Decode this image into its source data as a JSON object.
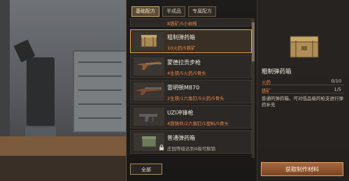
{
  "tabs": [
    {
      "label": "基础配方"
    },
    {
      "label": "半成品"
    },
    {
      "label": "专属配方"
    }
  ],
  "list": {
    "top_partial": {
      "materials": "8铁矿/5小树枝"
    },
    "items": [
      {
        "name": "粗制弹药箱",
        "materials": "10火药/5铁矿"
      },
      {
        "name": "蒙德拉贡步枪",
        "materials": "4生铁/5火药/5骨头"
      },
      {
        "name": "雷明顿M870",
        "materials": "2生铁/1六角钉/5火药/5骨头"
      },
      {
        "name": "UZI冲锋枪",
        "materials": "4铁铸件/2六角钉/1塑料/5骨头"
      },
      {
        "name": "普通弹药箱",
        "materials": "庄园等级达到4级可解锁"
      }
    ]
  },
  "all_button": "全部",
  "detail": {
    "title": "粗制弹药箱",
    "requirements": [
      {
        "label": "火药",
        "value": "0/10"
      },
      {
        "label": "铁矿",
        "value": "1/5"
      }
    ],
    "description": "普通的弹药箱，可对低品级的枪支进行弹药补充",
    "action_button": "获取制作材料"
  },
  "colors": {
    "accent_orange": "#f08a48",
    "selected_border": "#e2a853",
    "button_brown": "#8a4e2c"
  }
}
